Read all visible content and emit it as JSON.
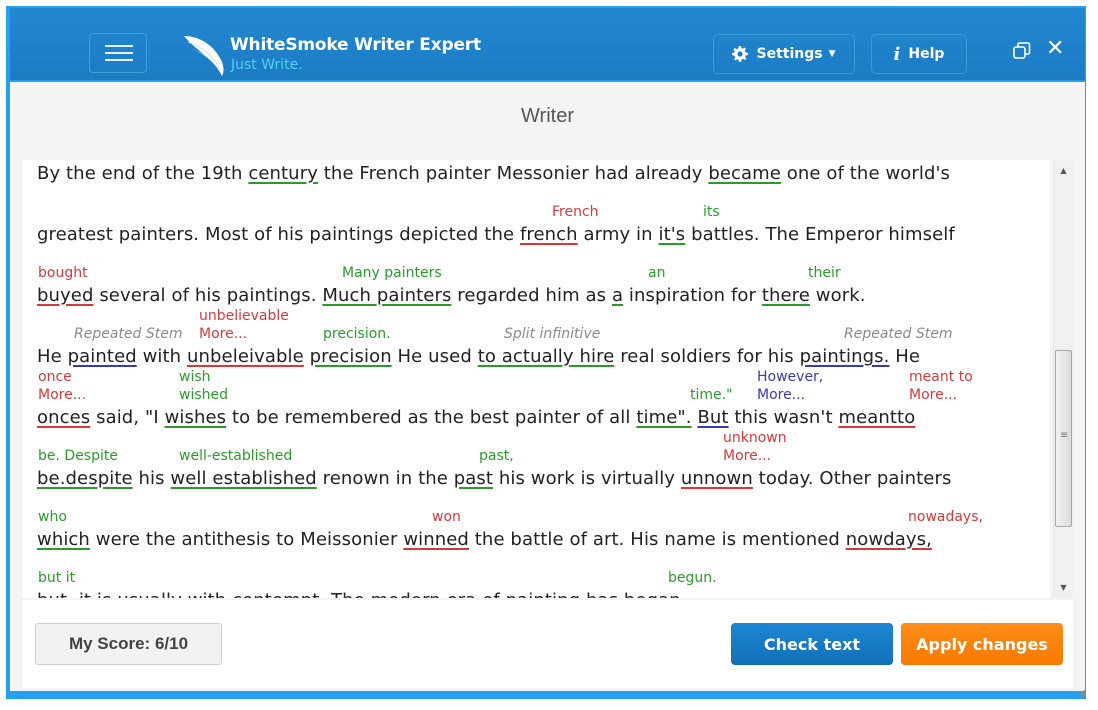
{
  "app": {
    "title": "WhiteSmoke Writer Expert",
    "tagline": "Just Write.",
    "settings_label": "Settings",
    "help_label": "Help",
    "icons": {
      "menu": "hamburger-icon",
      "logo": "feather-icon",
      "settings": "gear-icon",
      "settings_caret": "caret-down-icon",
      "help": "info-icon",
      "restore": "restore-window-icon",
      "close": "close-icon"
    },
    "colors": {
      "titlebar": "#1b7cc4",
      "frame": "#23a0ee",
      "tagline": "#4fd0f5",
      "error_red": "#d9383a",
      "suggestion_green": "#2b9c2b",
      "style_blue": "#3a3ab0",
      "note_gray": "#8a8a8a",
      "check_button": "#1677c2",
      "apply_button": "#f98300"
    }
  },
  "page": {
    "title": "Writer"
  },
  "editor": {
    "lines": [
      {
        "segments": [
          {
            "text": "By the end of the 19th "
          },
          {
            "text": "century",
            "mark": "green"
          },
          {
            "text": " the French painter Messonier had already "
          },
          {
            "text": "became",
            "mark": "green"
          },
          {
            "text": " one of the world's"
          }
        ],
        "suggestions": []
      },
      {
        "segments": [
          {
            "text": "greatest painters. Most of his paintings depicted the "
          },
          {
            "text": "french",
            "mark": "red"
          },
          {
            "text": " army in "
          },
          {
            "text": "it's",
            "mark": "green"
          },
          {
            "text": " battles. The Emperor himself"
          }
        ],
        "suggestions": [
          {
            "text": "French",
            "color": "red"
          },
          {
            "text": "its",
            "color": "green"
          }
        ]
      },
      {
        "segments": [
          {
            "text": "buyed",
            "mark": "red"
          },
          {
            "text": " several of his paintings. "
          },
          {
            "text": "Much painters",
            "mark": "green"
          },
          {
            "text": " regarded him as "
          },
          {
            "text": "a",
            "mark": "green"
          },
          {
            "text": " inspiration for "
          },
          {
            "text": "there",
            "mark": "green"
          },
          {
            "text": " work."
          }
        ],
        "suggestions": [
          {
            "text": "bought",
            "color": "red"
          },
          {
            "text": "Many painters",
            "color": "green"
          },
          {
            "text": "an",
            "color": "green"
          },
          {
            "text": "their",
            "color": "green"
          }
        ]
      },
      {
        "segments": [
          {
            "text": "He "
          },
          {
            "text": "painted",
            "mark": "blue"
          },
          {
            "text": " with "
          },
          {
            "text": "unbeleivable",
            "mark": "red"
          },
          {
            "text": " "
          },
          {
            "text": "precision",
            "mark": "green"
          },
          {
            "text": " He used "
          },
          {
            "text": "to actually hire",
            "mark": "green"
          },
          {
            "text": " real soldiers for his "
          },
          {
            "text": "paintings.",
            "mark": "blue"
          },
          {
            "text": " He"
          }
        ],
        "suggestions": [
          {
            "text": "Repeated Stem",
            "color": "gray"
          },
          {
            "text": "unbelievable",
            "color": "red"
          },
          {
            "text": "More...",
            "color": "red"
          },
          {
            "text": "precision.",
            "color": "green"
          },
          {
            "text": "Split infinitive",
            "color": "gray"
          },
          {
            "text": "Repeated Stem",
            "color": "gray"
          }
        ]
      },
      {
        "segments": [
          {
            "text": "onces",
            "mark": "red"
          },
          {
            "text": " said, \"I "
          },
          {
            "text": "wishes",
            "mark": "green"
          },
          {
            "text": " to be remembered as the best painter of all "
          },
          {
            "text": "time\".",
            "mark": "green"
          },
          {
            "text": " "
          },
          {
            "text": "But",
            "mark": "blue"
          },
          {
            "text": " this wasn't "
          },
          {
            "text": "meantto",
            "mark": "red"
          }
        ],
        "suggestions": [
          {
            "text": "once",
            "color": "red"
          },
          {
            "text": "More...",
            "color": "red"
          },
          {
            "text": "wish",
            "color": "green"
          },
          {
            "text": "wished",
            "color": "green"
          },
          {
            "text": "time.\"",
            "color": "green"
          },
          {
            "text": "However,",
            "color": "blue"
          },
          {
            "text": "More...",
            "color": "blue"
          },
          {
            "text": "meant to",
            "color": "red"
          },
          {
            "text": "More...",
            "color": "red"
          }
        ]
      },
      {
        "segments": [
          {
            "text": "be.despite",
            "mark": "green"
          },
          {
            "text": " his "
          },
          {
            "text": "well established",
            "mark": "green"
          },
          {
            "text": " renown in the "
          },
          {
            "text": "past",
            "mark": "green"
          },
          {
            "text": " his work is virtually "
          },
          {
            "text": "unnown",
            "mark": "red"
          },
          {
            "text": " today. Other painters"
          }
        ],
        "suggestions": [
          {
            "text": "be. Despite",
            "color": "green"
          },
          {
            "text": "well-established",
            "color": "green"
          },
          {
            "text": "past,",
            "color": "green"
          },
          {
            "text": "unknown",
            "color": "red"
          },
          {
            "text": "More...",
            "color": "red"
          }
        ]
      },
      {
        "segments": [
          {
            "text": "which",
            "mark": "green"
          },
          {
            "text": " were the antithesis to Meissonier "
          },
          {
            "text": "winned",
            "mark": "red"
          },
          {
            "text": " the battle of art. His name is mentioned "
          },
          {
            "text": "nowdays,",
            "mark": "red"
          }
        ],
        "suggestions": [
          {
            "text": "who",
            "color": "green"
          },
          {
            "text": "won",
            "color": "red"
          },
          {
            "text": "nowadays,",
            "color": "red"
          }
        ]
      },
      {
        "segments": [
          {
            "text": "but, it is usually with contempt. The modern era of painting has began"
          }
        ],
        "suggestions": [
          {
            "text": "but it",
            "color": "green"
          },
          {
            "text": "begun.",
            "color": "green"
          }
        ]
      }
    ]
  },
  "footer": {
    "score_label": "My Score: 6/10",
    "check_label": "Check text",
    "apply_label": "Apply changes"
  }
}
